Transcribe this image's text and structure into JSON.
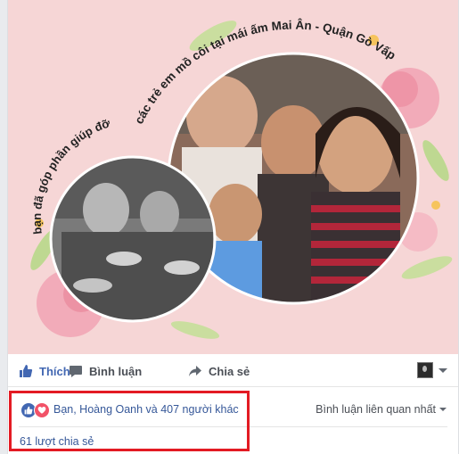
{
  "post_image": {
    "arc_text_left": "bạn đã góp phần giúp đỡ",
    "arc_text_right": "các trẻ em mồ côi tại mái ấm Mai Ân - Quận Gò Vấp"
  },
  "actions": {
    "like_label": "Thích",
    "comment_label": "Bình luận",
    "share_label": "Chia sẻ"
  },
  "reactions": {
    "summary": "Bạn, Hoàng Oanh và 407 người khác",
    "icons": [
      "like-icon",
      "love-icon"
    ]
  },
  "comments_sort": {
    "label": "Bình luận liên quan nhất"
  },
  "shares": {
    "label": "61 lượt chia sẻ"
  },
  "colors": {
    "accent": "#4267b2",
    "highlight": "#e31b23",
    "image_bg": "#f6d6d6"
  }
}
